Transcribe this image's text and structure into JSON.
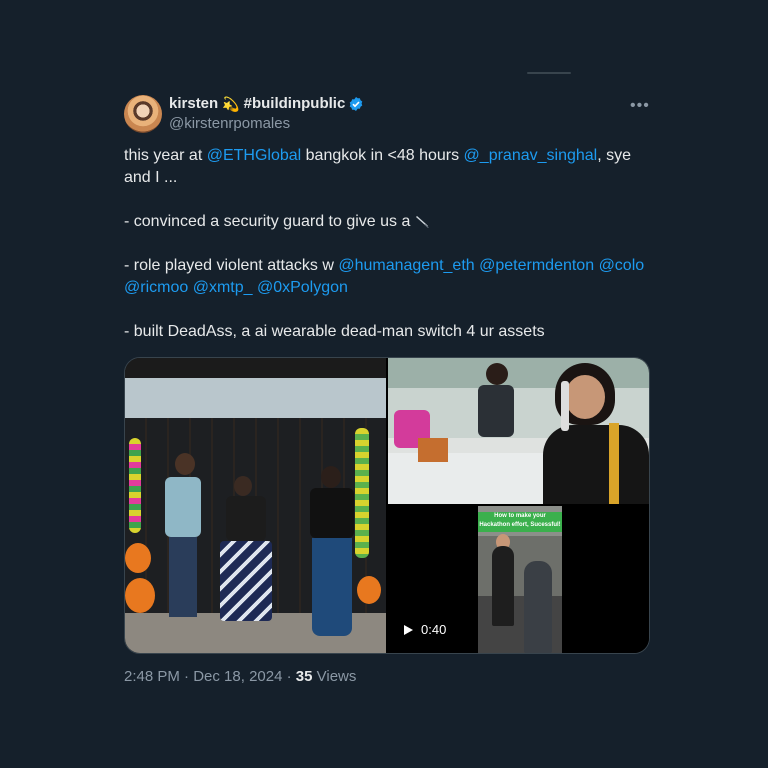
{
  "author": {
    "name": "kirsten",
    "emoji": "💫",
    "tag": "#buildinpublic",
    "handle": "@kirstenrpomales"
  },
  "more_label": "•••",
  "tweet": {
    "line1_a": "this year at ",
    "line1_m1": "@ETHGlobal",
    "line1_b": " bangkok in <48 hours ",
    "line1_m2": "@_pranav_singhal",
    "line1_c": ", sye and I ...",
    "bullet1": "- convinced a security guard to give us a ",
    "bullet2_a": "- role played violent attacks w ",
    "bullet2_mentions": [
      "@humanagent_eth",
      "@petermdenton",
      "@colo",
      "@ricmoo",
      "@xmtp_",
      "@0xPolygon"
    ],
    "bullet3": "- built DeadAss, a ai wearable dead-man switch 4 ur assets"
  },
  "media": {
    "video_banner": "How to make your Hackathon effort, Sucessful!",
    "video_duration": "0:40"
  },
  "meta": {
    "time": "2:48 PM",
    "sep1": " · ",
    "date": "Dec 18, 2024",
    "sep2": " · ",
    "views": "35",
    "views_label": " Views"
  },
  "colors": {
    "background": "#15202b",
    "link": "#1d9bf0",
    "text": "#e7e9ea",
    "muted": "#8b98a5"
  }
}
